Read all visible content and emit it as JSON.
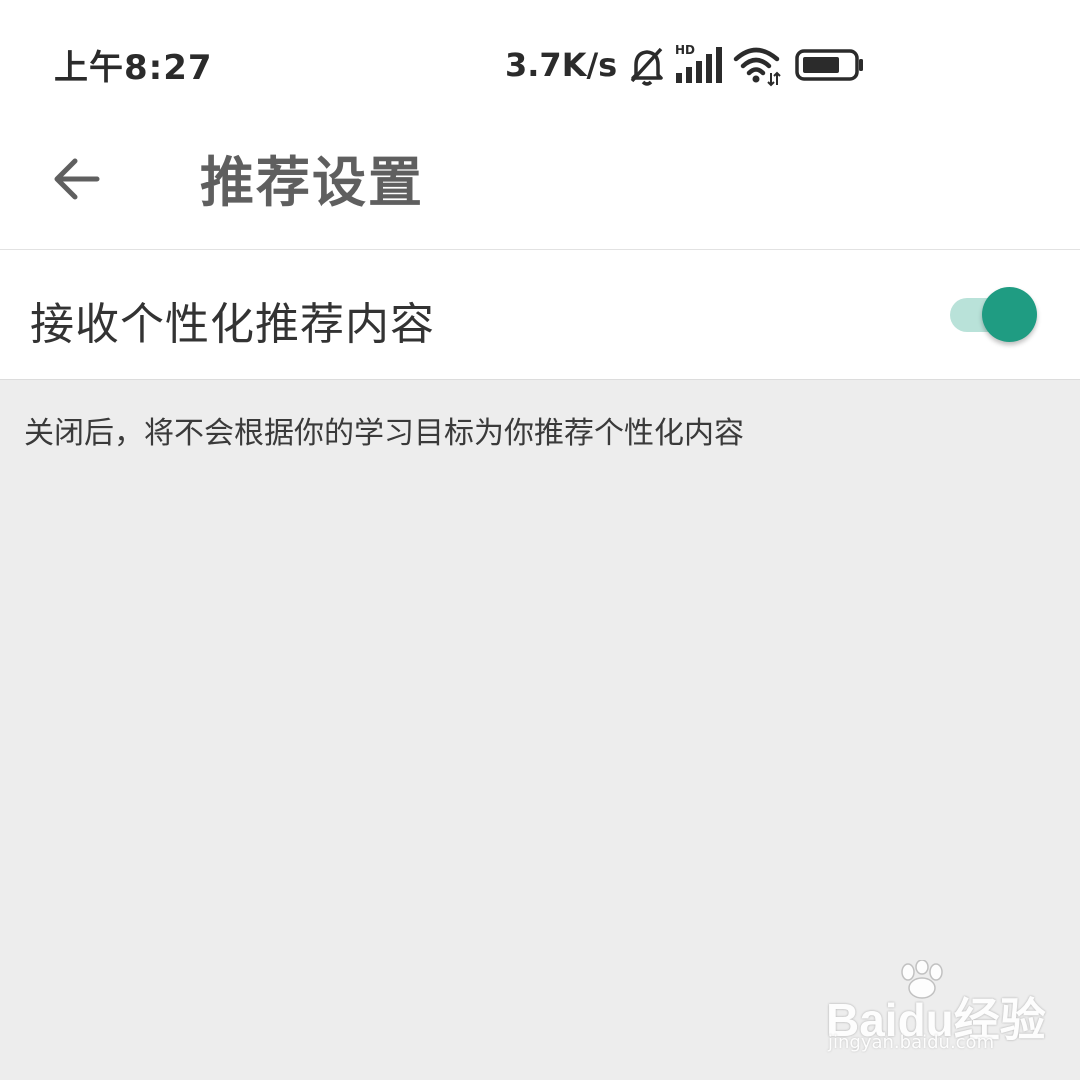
{
  "status_bar": {
    "time": "上午8:27",
    "net_speed": "3.7K/s",
    "icons": [
      "bell-off-icon",
      "signal-hd-icon",
      "wifi-icon",
      "battery-icon"
    ]
  },
  "app_bar": {
    "back_icon": "arrow-left-icon",
    "title": "推荐设置"
  },
  "setting": {
    "label": "接收个性化推荐内容",
    "enabled": true,
    "description": "关闭后，将不会根据你的学习目标为你推荐个性化内容"
  },
  "watermark": {
    "logo_text": "Baidu经验",
    "url": "jingyan.baidu.com"
  },
  "colors": {
    "accent": "#1f9c82",
    "accent_light": "#b9e2d9",
    "background": "#ededed"
  }
}
